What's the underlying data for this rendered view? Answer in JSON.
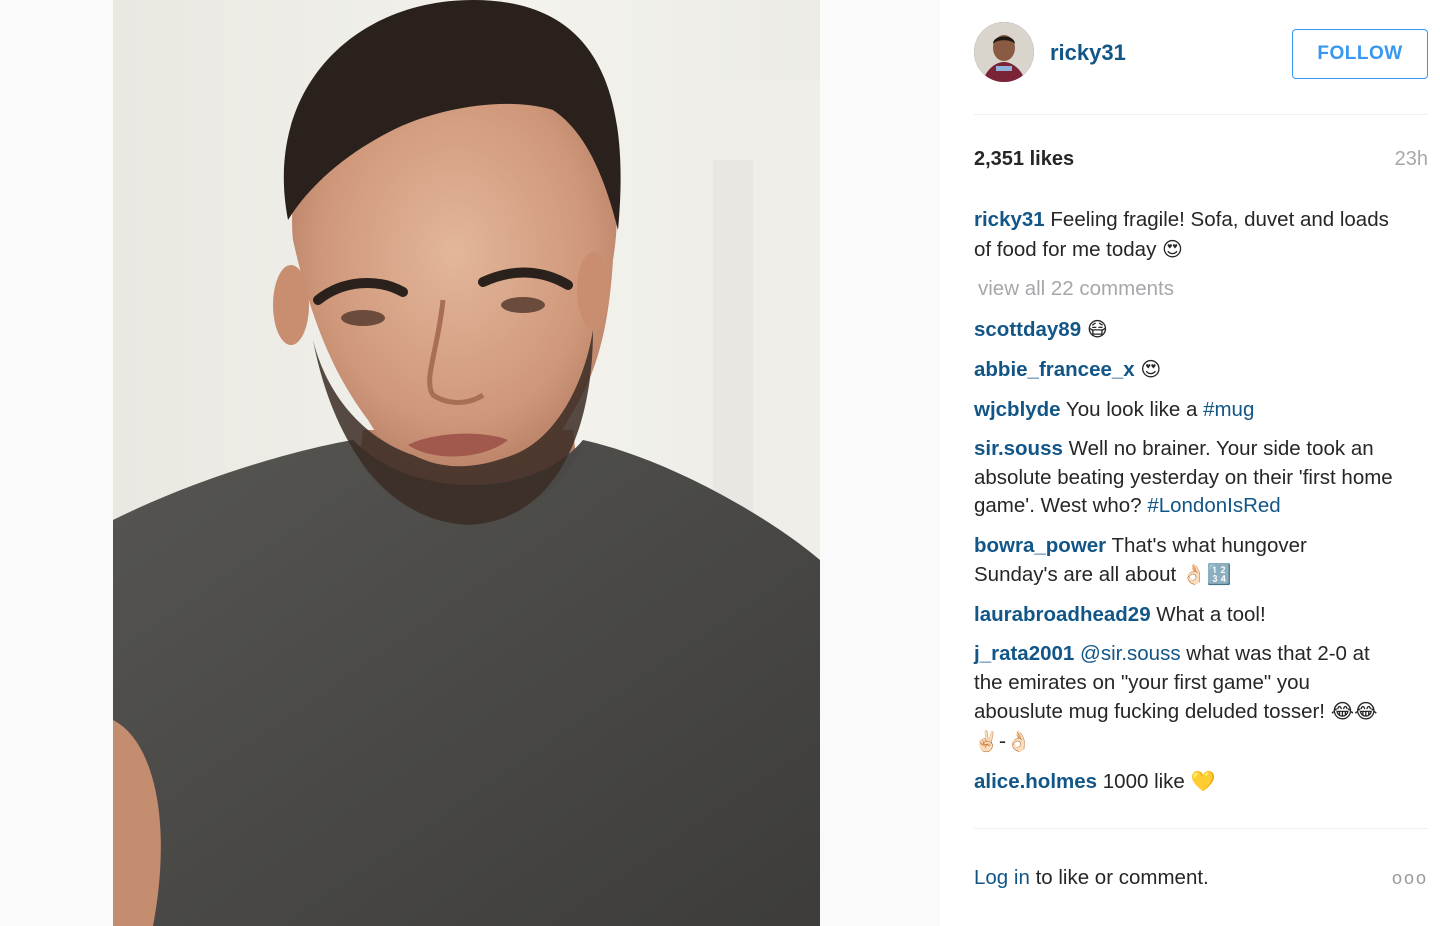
{
  "post": {
    "photo_alt": "selfie of a bearded man in a grey t-shirt",
    "author": "ricky31",
    "follow_label": "FOLLOW",
    "likes": "2,351 likes",
    "time": "23h",
    "caption": {
      "user": "ricky31",
      "text": "Feeling fragile! Sofa, duvet and loads of food for me today",
      "emoji": "😍"
    },
    "view_all": "view all 22 comments",
    "comments": [
      {
        "user": "scottday89",
        "text": "",
        "emoji": "😷"
      },
      {
        "user": "abbie_francee_x",
        "text": "",
        "emoji": "😍"
      },
      {
        "user": "wjcblyde",
        "text": "You look like a",
        "tag": "#mug"
      },
      {
        "user": "sir.souss",
        "text": "Well no brainer. Your side took an absolute beating yesterday on their 'first home game'. West who?",
        "tag": "#LondonIsRed"
      },
      {
        "user": "bowra_power",
        "text": "That's what hungover Sunday's are all about",
        "emoji": "👌🏻🔢"
      },
      {
        "user": "laurabroadhead29",
        "text": "What a tool!"
      },
      {
        "user": "j_rata2001",
        "mention": "@sir.souss",
        "text": "what was that 2-0 at the emirates on \"your first game\" you abouslute mug fucking deluded tosser!",
        "emoji": "😂😂 ✌🏻-👌🏻"
      },
      {
        "user": "alice.holmes",
        "text": "1000 like",
        "emoji": "💛"
      }
    ],
    "footer": {
      "login_link": "Log in",
      "login_text": "to like or comment.",
      "more": "ooo"
    }
  }
}
